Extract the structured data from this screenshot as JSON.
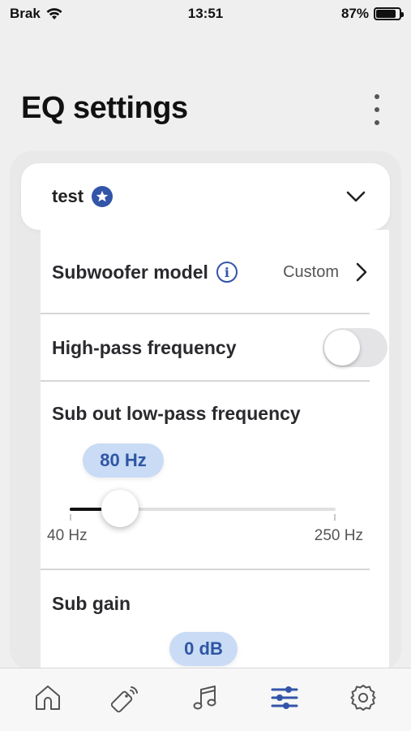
{
  "status_bar": {
    "carrier": "Brak",
    "time": "13:51",
    "battery": "87%",
    "battery_level": 0.87
  },
  "header": {
    "title": "EQ settings",
    "more_icon": "more-vertical-icon"
  },
  "profile": {
    "name": "test",
    "badge_icon": "star-badge-icon",
    "expand_icon": "chevron-down-icon"
  },
  "settings": {
    "subwoofer_model": {
      "label": "Subwoofer model",
      "value": "Custom"
    },
    "high_pass": {
      "label": "High-pass frequency",
      "enabled": false
    },
    "low_pass": {
      "label": "Sub out low-pass frequency",
      "value_label": "80 Hz",
      "value": 80,
      "min_label": "40 Hz",
      "max_label": "250 Hz",
      "min": 40,
      "max": 250
    },
    "sub_gain": {
      "label": "Sub gain",
      "value_label": "0 dB"
    }
  },
  "tab_bar": {
    "tabs": [
      {
        "icon": "home-icon",
        "active": false
      },
      {
        "icon": "tag-icon",
        "active": false
      },
      {
        "icon": "music-icon",
        "active": false
      },
      {
        "icon": "sliders-icon",
        "active": true
      },
      {
        "icon": "settings-icon",
        "active": false
      }
    ]
  },
  "colors": {
    "accent": "#3355a8",
    "chip_bg": "#c9dbf5",
    "background": "#efefef"
  }
}
